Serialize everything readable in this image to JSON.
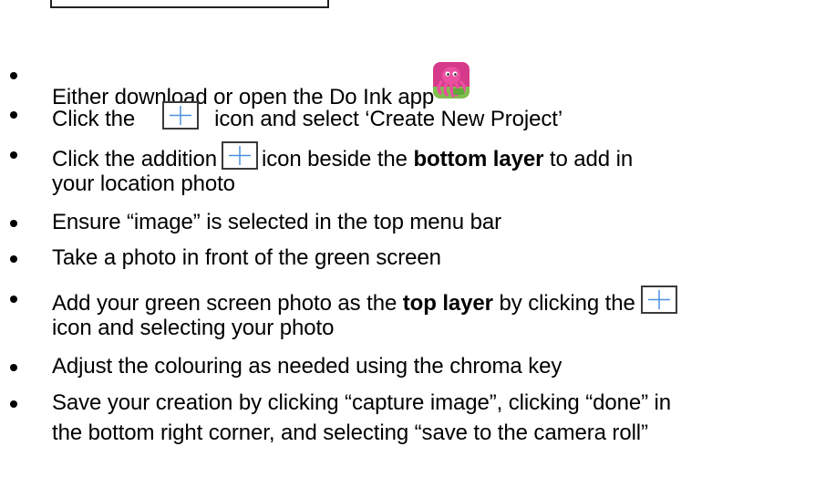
{
  "icons": {
    "app": "do-ink-octopus-app-icon",
    "plus": "plus-icon",
    "plus_color": "#4a90e2",
    "app_bg": "#d63a8a",
    "app_ground": "#7fbf4d"
  },
  "steps": [
    {
      "text_a": "Either download or open the Do Ink app"
    },
    {
      "text_a": "Click the",
      "text_b": "icon and select ‘Create New Project’"
    },
    {
      "text_a": "Click the addition",
      "text_b": "icon beside the",
      "bold": "bottom layer",
      "text_c": "to add in",
      "line2": "your location photo"
    },
    {
      "text_a": "Ensure “image” is selected in the top menu bar"
    },
    {
      "text_a": "Take a photo in front of the green screen"
    },
    {
      "text_a": "Add your green screen photo as the",
      "bold": "top layer",
      "text_b": "by clicking the",
      "line2": "icon and selecting your photo"
    },
    {
      "text_a": "Adjust the colouring as needed using the chroma key"
    },
    {
      "text_a": "Save your creation by clicking “capture image”, clicking “done” in",
      "line2": "the bottom right corner, and selecting “save to the camera roll”"
    }
  ]
}
